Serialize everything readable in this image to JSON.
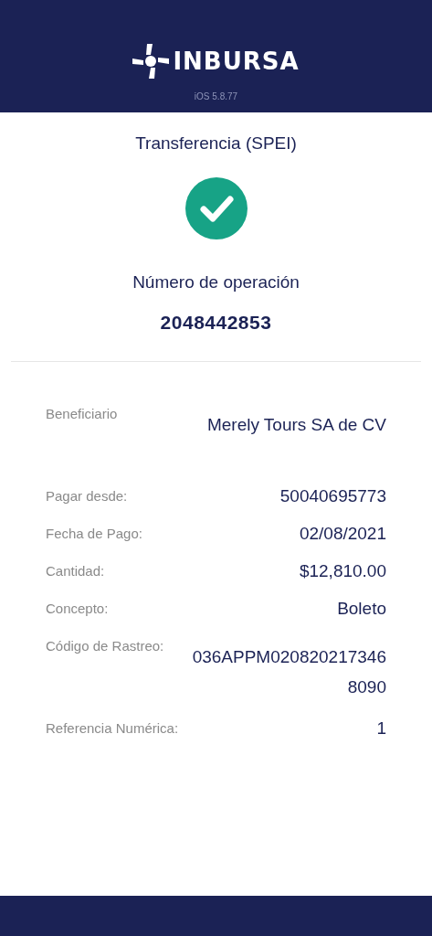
{
  "header": {
    "brand": "INBURSA",
    "version": "iOS 5.8.77"
  },
  "title": "Transferencia (SPEI)",
  "operation": {
    "label": "Número de operación",
    "number": "2048442853"
  },
  "details": [
    {
      "label": "Beneficiario",
      "value": "Merely Tours SA de CV"
    },
    {
      "label": "Pagar desde:",
      "value": "50040695773"
    },
    {
      "label": "Fecha de Pago:",
      "value": "02/08/2021"
    },
    {
      "label": "Cantidad:",
      "value": "$12,810.00"
    },
    {
      "label": "Concepto:",
      "value": "Boleto"
    },
    {
      "label": "Código de Rastreo:",
      "value": "036APPM0208202173468090"
    },
    {
      "label": "Referencia Numérica:",
      "value": "1"
    }
  ]
}
